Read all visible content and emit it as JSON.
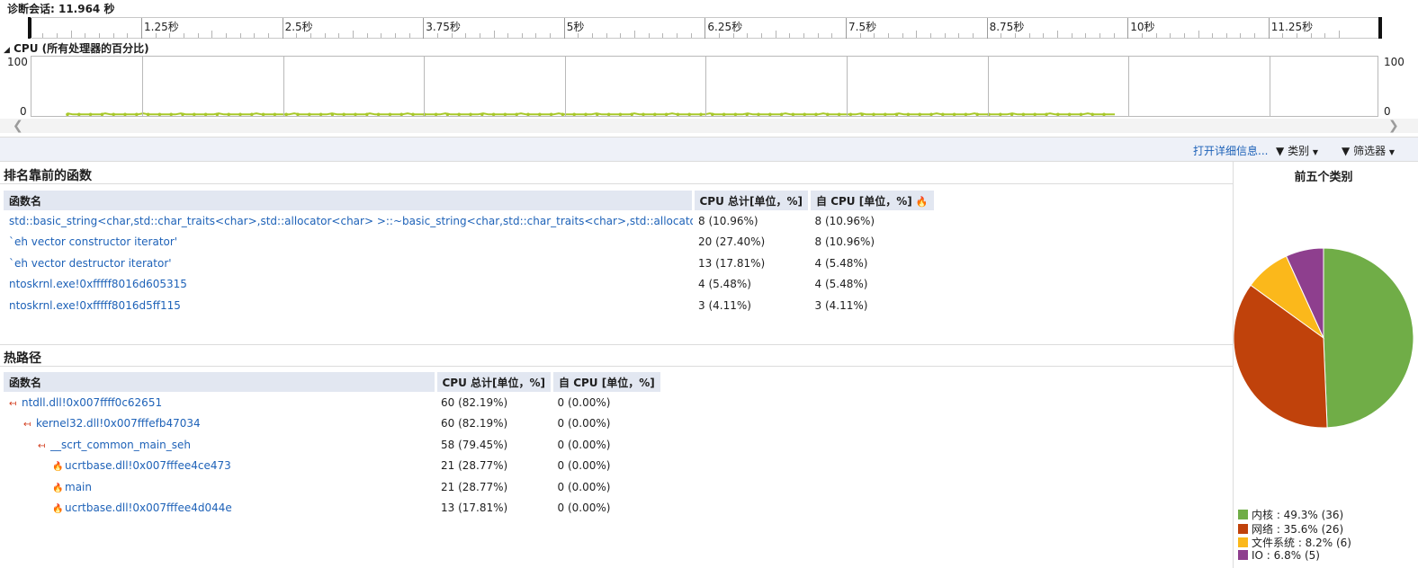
{
  "session": {
    "label": "诊断会话: 11.964 秒"
  },
  "ruler": {
    "labels": [
      "1.25秒",
      "2.5秒",
      "3.75秒",
      "5秒",
      "6.25秒",
      "7.5秒",
      "8.75秒",
      "10秒",
      "11.25秒"
    ]
  },
  "cpu_graph": {
    "title": "CPU (所有处理器的百分比)",
    "y_max_label": "100",
    "y_min_label": "0",
    "activity_level_percent": 1
  },
  "toolbar": {
    "open_details": "打开详细信息...",
    "category": "类别",
    "filter": "筛选器"
  },
  "top_functions": {
    "title": "排名靠前的函数",
    "columns": [
      "函数名",
      "CPU 总计[单位，%]",
      "自 CPU [单位，%]"
    ],
    "rows": [
      [
        "std::basic_string<char,std::char_traits<char>,std::allocator<char> >::~basic_string<char,std::char_traits<char>,std::allocator<char> >",
        "8 (10.96%)",
        "8 (10.96%)"
      ],
      [
        "`eh vector constructor iterator'",
        "20 (27.40%)",
        "8 (10.96%)"
      ],
      [
        "`eh vector destructor iterator'",
        "13 (17.81%)",
        "4 (5.48%)"
      ],
      [
        "ntoskrnl.exe!0xfffff8016d605315",
        "4 (5.48%)",
        "4 (5.48%)"
      ],
      [
        "ntoskrnl.exe!0xfffff8016d5ff115",
        "3 (4.11%)",
        "3 (4.11%)"
      ]
    ]
  },
  "hot_path": {
    "title": "热路径",
    "columns": [
      "函数名",
      "CPU 总计[单位，%]",
      "自 CPU [单位，%]"
    ],
    "rows": [
      {
        "name": "ntdll.dll!0x007ffff0c62651",
        "total": "60 (82.19%)",
        "self": "0 (0.00%)",
        "indent": 0,
        "icon": "hot-path-arrow-icon"
      },
      {
        "name": "kernel32.dll!0x007fffefb47034",
        "total": "60 (82.19%)",
        "self": "0 (0.00%)",
        "indent": 1,
        "icon": "hot-path-arrow-icon"
      },
      {
        "name": "__scrt_common_main_seh",
        "total": "58 (79.45%)",
        "self": "0 (0.00%)",
        "indent": 2,
        "icon": "hot-path-arrow-icon"
      },
      {
        "name": "ucrtbase.dll!0x007fffee4ce473",
        "total": "21 (28.77%)",
        "self": "0 (0.00%)",
        "indent": 3,
        "icon": "flame-icon"
      },
      {
        "name": "main",
        "total": "21 (28.77%)",
        "self": "0 (0.00%)",
        "indent": 3,
        "icon": "flame-icon"
      },
      {
        "name": "ucrtbase.dll!0x007fffee4d044e",
        "total": "13 (17.81%)",
        "self": "0 (0.00%)",
        "indent": 3,
        "icon": "flame-icon"
      }
    ]
  },
  "top_categories": {
    "title": "前五个类别",
    "items": [
      {
        "label": "内核 : 49.3% (36)",
        "percent": 49.3,
        "color": "#70ad47"
      },
      {
        "label": "网络 : 35.6% (26)",
        "percent": 35.6,
        "color": "#c0420b"
      },
      {
        "label": "文件系统 : 8.2% (6)",
        "percent": 8.2,
        "color": "#fbb81b"
      },
      {
        "label": "IO : 6.8% (5)",
        "percent": 6.8,
        "color": "#8e3f8e"
      }
    ]
  },
  "colors": {
    "link": "#1e62b8",
    "cpu_line": "#a8c82a",
    "header_bg": "#e2e7f1",
    "flame": "#d23a1a"
  }
}
